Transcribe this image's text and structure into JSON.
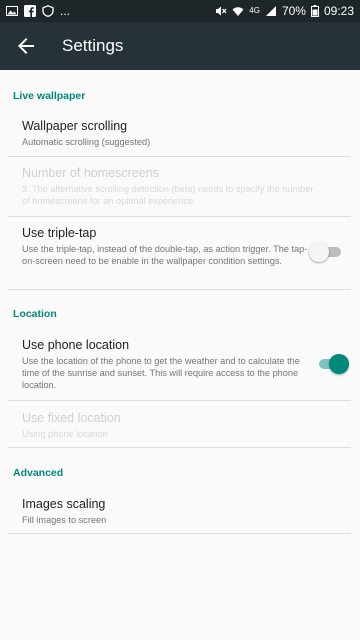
{
  "status_bar": {
    "left_icons": [
      "gallery-icon",
      "facebook-icon",
      "vpn-shield-icon"
    ],
    "more": "...",
    "network": "4G",
    "battery": "70%",
    "time": "09:23"
  },
  "toolbar": {
    "title": "Settings",
    "back_icon": "arrow-left-icon"
  },
  "sections": {
    "live_wallpaper": "Live wallpaper",
    "location": "Location",
    "advanced": "Advanced"
  },
  "prefs": {
    "wallpaper_scrolling": {
      "title": "Wallpaper scrolling",
      "summary": "Automatic scrolling (suggested)"
    },
    "number_of_homescreens": {
      "title": "Number of homescreens",
      "summary": "3. The alternative scrolling detection (beta) needs to specify the number of homescreens for an optimal experience"
    },
    "use_triple_tap": {
      "title": "Use triple-tap",
      "summary": "Use the triple-tap, instead of the double-tap, as action trigger. The tap-on-screen need to be enable in the wallpaper condition settings.",
      "checked": false
    },
    "use_phone_location": {
      "title": "Use phone location",
      "summary": "Use the location of the phone to get the weather and to calculate the time of the sunrise and sunset. This will require access to the phone location.",
      "checked": true
    },
    "use_fixed_location": {
      "title": "Use fixed location",
      "summary": "Using phone location"
    },
    "images_scaling": {
      "title": "Images scaling",
      "summary": "Fill images to screen"
    }
  },
  "colors": {
    "accent": "#00897b",
    "toolbar": "#263238",
    "statusbar": "#1f262a"
  }
}
